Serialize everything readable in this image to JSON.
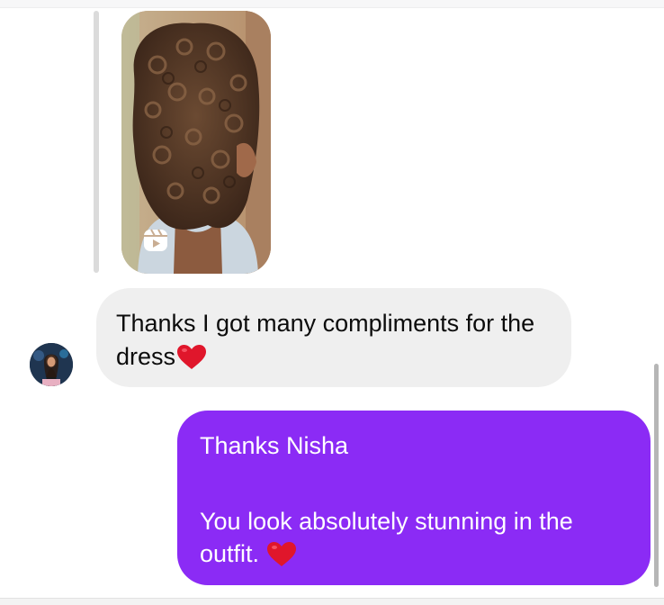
{
  "conversation": {
    "shared_reel": {
      "thumbnail_description": "Photo of a person with curly hair",
      "icon": "reels-icon"
    },
    "messages": [
      {
        "direction": "incoming",
        "text": "Thanks I got many compliments for the dress",
        "emoji": "❤️"
      },
      {
        "direction": "outgoing",
        "line1": "Thanks Nisha",
        "line2": "You look absolutely stunning in the outfit.",
        "emoji": "❤️"
      }
    ],
    "avatar": {
      "name": "contact-avatar"
    }
  },
  "colors": {
    "incoming_bubble": "#efefef",
    "outgoing_bubble": "#8b2bf5",
    "heart": "#e0162b"
  }
}
